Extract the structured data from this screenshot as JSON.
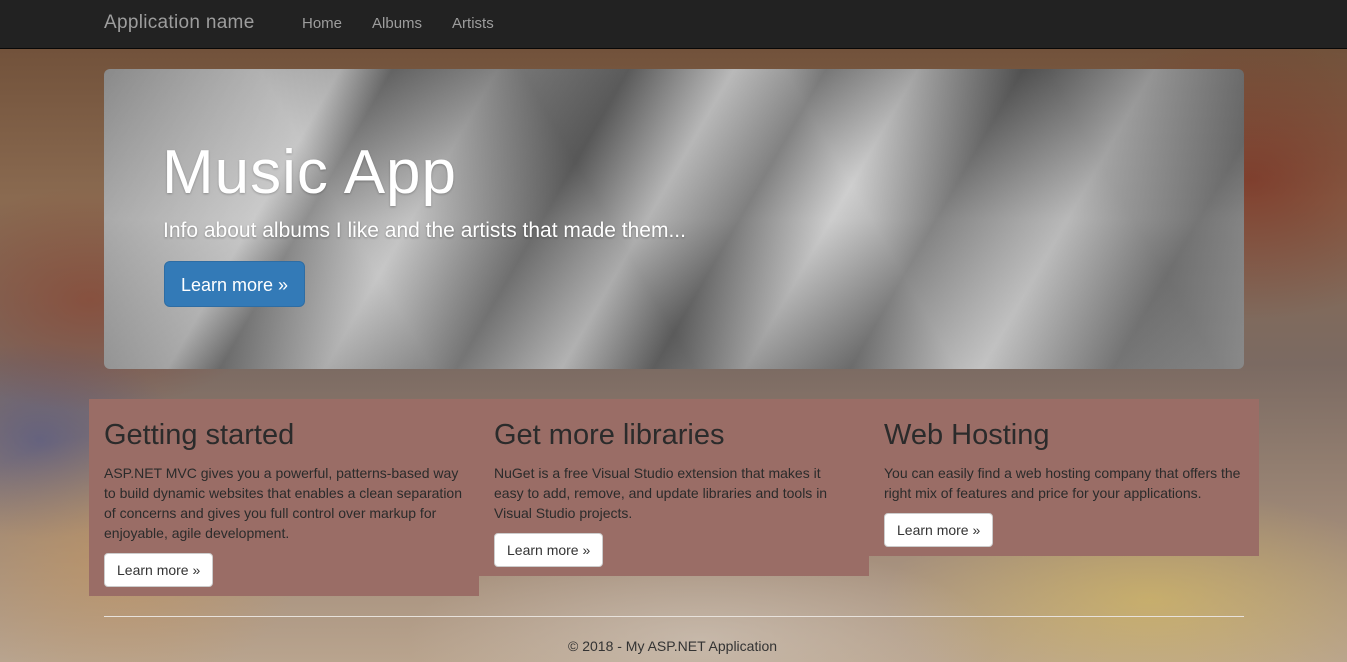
{
  "navbar": {
    "brand": "Application name",
    "links": [
      "Home",
      "Albums",
      "Artists"
    ]
  },
  "jumbotron": {
    "title": "Music App",
    "lead": "Info about albums I like and the artists that made them...",
    "button": "Learn more »"
  },
  "columns": [
    {
      "heading": "Getting started",
      "text": "ASP.NET MVC gives you a powerful, patterns-based way to build dynamic websites that enables a clean separation of concerns and gives you full control over markup for enjoyable, agile development.",
      "button": "Learn more »"
    },
    {
      "heading": "Get more libraries",
      "text": "NuGet is a free Visual Studio extension that makes it easy to add, remove, and update libraries and tools in Visual Studio projects.",
      "button": "Learn more »"
    },
    {
      "heading": "Web Hosting",
      "text": "You can easily find a web hosting company that offers the right mix of features and price for your applications.",
      "button": "Learn more »"
    }
  ],
  "footer": {
    "text": "© 2018 - My ASP.NET Application"
  },
  "colors": {
    "navbar_bg": "#222222",
    "nav_text": "#9d9d9d",
    "primary_button": "#337ab7",
    "column_bg": "#9a6d66"
  }
}
